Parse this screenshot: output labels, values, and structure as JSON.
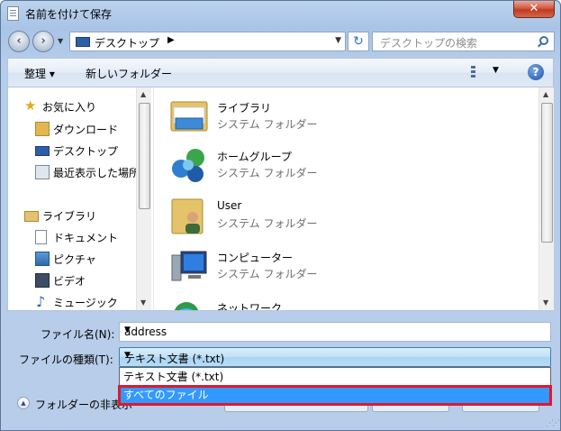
{
  "window": {
    "title": "名前を付けて保存",
    "close_label": "✕"
  },
  "address_bar": {
    "location": "デスクトップ",
    "search_placeholder": "デスクトップの検索"
  },
  "toolbar": {
    "organize_label": "整理 ▾",
    "new_folder_label": "新しいフォルダー"
  },
  "nav_tree": {
    "favorites": {
      "label": "お気に入り",
      "items": [
        "ダウンロード",
        "デスクトップ",
        "最近表示した場所"
      ]
    },
    "libraries": {
      "label": "ライブラリ",
      "items": [
        "ドキュメント",
        "ピクチャ",
        "ビデオ",
        "ミュージック"
      ]
    }
  },
  "items": [
    {
      "name": "ライブラリ",
      "type": "システム フォルダー",
      "icon": "library-icon"
    },
    {
      "name": "ホームグループ",
      "type": "システム フォルダー",
      "icon": "homegroup-icon"
    },
    {
      "name": "User",
      "type": "システム フォルダー",
      "icon": "user-folder-icon"
    },
    {
      "name": "コンピューター",
      "type": "システム フォルダー",
      "icon": "computer-icon"
    },
    {
      "name": "ネットワーク",
      "type": "",
      "icon": "network-icon"
    }
  ],
  "form": {
    "filename_label": "ファイル名(N):",
    "filename_value": "address",
    "filetype_label": "ファイルの種類(T):",
    "filetype_value": "テキスト文書 (*.txt)",
    "filetype_options": [
      "テキスト文書 (*.txt)",
      "すべてのファイル"
    ],
    "selected_option_index": 1
  },
  "footer": {
    "hide_folders_label": "フォルダーの非表示"
  },
  "colors": {
    "highlight": "#3399ff",
    "callout_border": "#e0182d"
  }
}
